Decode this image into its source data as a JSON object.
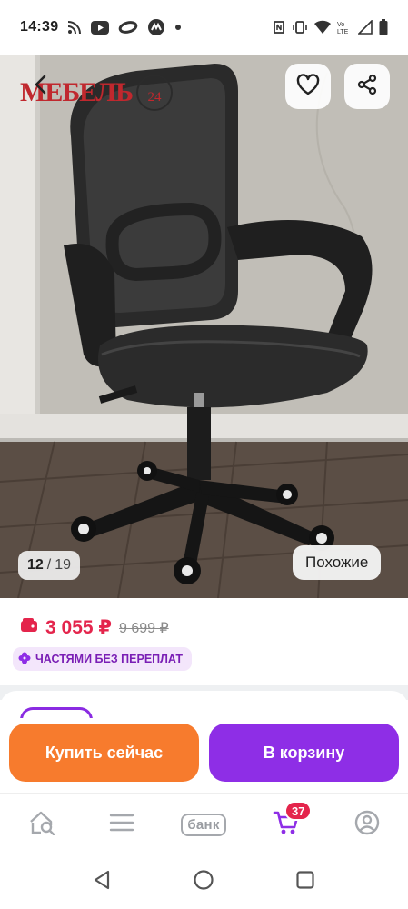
{
  "status_bar": {
    "time": "14:39",
    "icons_left": [
      "rss-icon",
      "youtube-icon",
      "ring-icon",
      "megamarket-icon",
      "dot-icon"
    ],
    "icons_right": [
      "nfc-icon",
      "vibrate-icon",
      "wifi-icon",
      "volte-icon",
      "signal-icon",
      "battery-icon"
    ]
  },
  "product_image": {
    "brand_logo_text": "МЕБЕЛЬ",
    "brand_logo_number": "24",
    "current_index": "12",
    "separator": "/",
    "total": "19",
    "similar_label": "Похожие"
  },
  "price": {
    "current": "3 055 ₽",
    "old": "9 699 ₽",
    "installment_label": "ЧАСТЯМИ БЕЗ ПЕРЕПЛАТ",
    "accent_color": "#e4254c"
  },
  "actions": {
    "buy_now_label": "Купить сейчас",
    "add_to_cart_label": "В корзину",
    "buy_color": "#f77b2d",
    "cart_color": "#8e2ee6"
  },
  "bottom_nav": {
    "items": [
      {
        "icon": "home-search-icon"
      },
      {
        "icon": "catalog-menu-icon"
      },
      {
        "label": "банк"
      },
      {
        "icon": "cart-icon",
        "badge": "37"
      },
      {
        "icon": "profile-icon"
      }
    ]
  },
  "system_nav": [
    "back-triangle-icon",
    "home-circle-icon",
    "recents-square-icon"
  ]
}
